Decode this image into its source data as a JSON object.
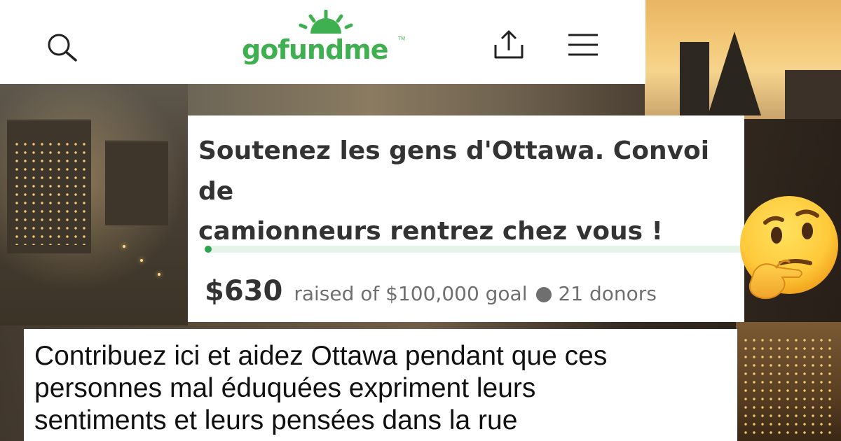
{
  "header": {
    "logo_text": "gofundme",
    "logo_tm": "TM",
    "icons": [
      "search-icon",
      "share-icon",
      "menu-icon"
    ]
  },
  "campaign": {
    "title_line1": "Soutenez les gens d'Ottawa. Convoi de",
    "title_line2": "camionneurs rentrez chez vous !",
    "raised": "$630",
    "raised_text": "raised of $100,000 goal",
    "donors": "21 donors",
    "progress_fraction": 0.0063
  },
  "description": {
    "line1": "Contribuez ici et aidez Ottawa pendant que ces",
    "line2": "personnes mal éduquées expriment leurs",
    "line3": "sentiments et leurs pensées dans la rue"
  },
  "overlay": {
    "emoji": "thinking-face-emoji"
  },
  "colors": {
    "brand_green": "#3fb04f",
    "progress_green": "#2da44e",
    "progress_track": "#e5f3e8",
    "text_dark": "#333333",
    "text_muted": "#6f6f6f"
  }
}
